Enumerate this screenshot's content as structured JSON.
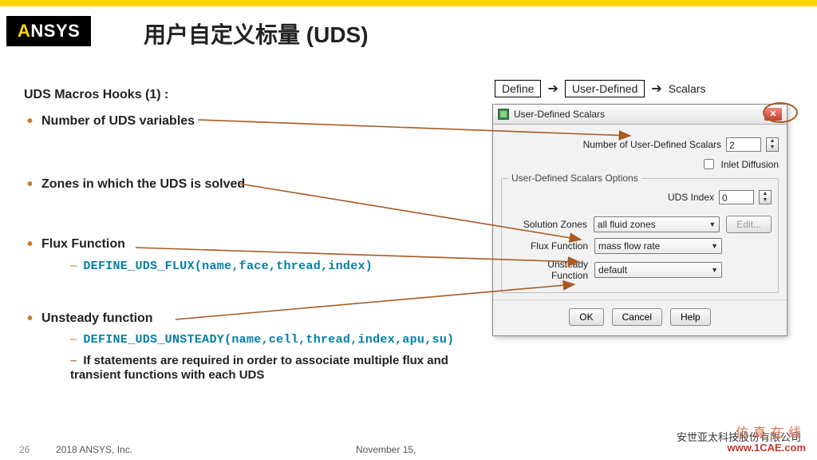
{
  "logo": {
    "a": "A",
    "rest": "NSYS"
  },
  "title": "用户自定义标量 (UDS)",
  "subhead": "UDS Macros Hooks (1) :",
  "bullets": {
    "b1": "Number of UDS variables",
    "b2": "Zones in which the UDS is solved",
    "b3": "Flux Function",
    "b3_code": "DEFINE_UDS_FLUX(name,face,thread,index)",
    "b4": "Unsteady function",
    "b4_code": "DEFINE_UDS_UNSTEADY(name,cell,thread,index,apu,su)",
    "b4_note": "If statements are required in order to associate multiple flux and transient functions with each UDS"
  },
  "crumbs": {
    "c1": "Define",
    "c2": "User-Defined",
    "c3": "Scalars"
  },
  "dialog": {
    "title": "User-Defined Scalars",
    "num_label": "Number of User-Defined Scalars",
    "num_value": "2",
    "inlet": "Inlet Diffusion",
    "group": "User-Defined Scalars Options",
    "uds_index_label": "UDS Index",
    "uds_index_value": "0",
    "solz_label": "Solution Zones",
    "solz_value": "all fluid zones",
    "edit": "Edit...",
    "flux_label": "Flux Function",
    "flux_value": "mass flow rate",
    "unst_label": "Unsteady Function",
    "unst_value": "default",
    "ok": "OK",
    "cancel": "Cancel",
    "help": "Help"
  },
  "footer": {
    "slidenum": "26",
    "copy": "2018   ANSYS, Inc.",
    "date": "November 15,",
    "company": "安世亚太科技股份有限公司",
    "wm1": "仿真在线",
    "wm2": "www.1CAE.com"
  }
}
